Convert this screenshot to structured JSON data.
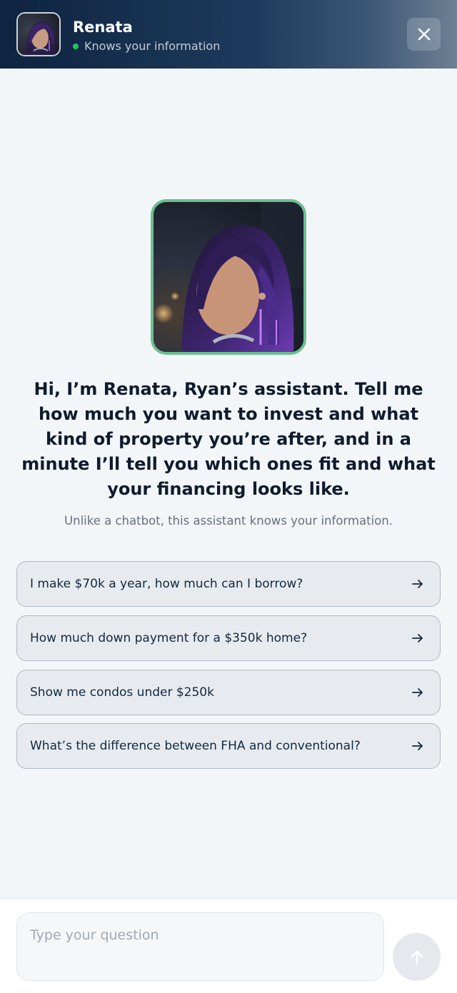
{
  "header": {
    "name": "Renata",
    "status": "Knows your information"
  },
  "main": {
    "greeting": "Hi, I’m Renata, Ryan’s assistant. Tell me how much you want to invest and what kind of property you’re after, and in a minute I’ll tell you which ones fit and what your financing looks like.",
    "subtext": "Unlike a chatbot, this assistant knows your information."
  },
  "suggestions": [
    {
      "label": "I make $70k a year, how much can I borrow?"
    },
    {
      "label": "How much down payment for a $350k home?"
    },
    {
      "label": "Show me condos under $250k"
    },
    {
      "label": "What’s the difference between FHA and conventional?"
    }
  ],
  "composer": {
    "placeholder": "Type your question",
    "value": ""
  },
  "colors": {
    "status_online": "#22c55e",
    "avatar_border": "#6cbf90",
    "header_dark": "#0e2440"
  },
  "icons": {
    "close": "close-icon",
    "suggestion_arrow": "arrow-right-icon",
    "send": "arrow-up-icon"
  }
}
